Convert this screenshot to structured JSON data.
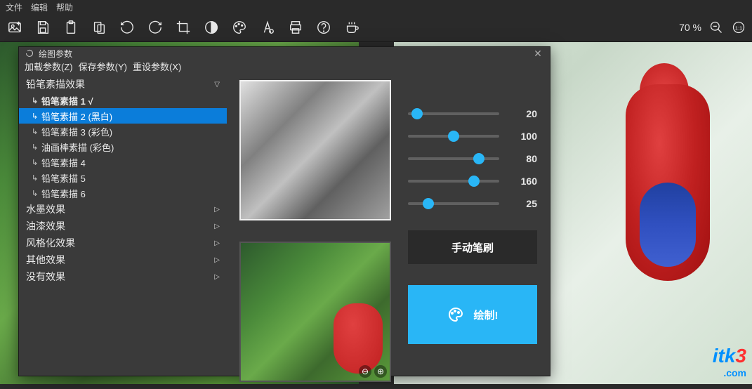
{
  "menubar": {
    "items": [
      "文件",
      "编辑",
      "帮助"
    ]
  },
  "zoom": {
    "level": "70 %"
  },
  "dialog": {
    "title": "绘图参数",
    "menu": {
      "load": "加载参数(Z)",
      "save": "保存参数(Y)",
      "reset": "重设参数(X)"
    },
    "categories": {
      "pencil": {
        "label": "铅笔素描效果",
        "expanded": true
      },
      "ink": {
        "label": "水墨效果"
      },
      "paint": {
        "label": "油漆效果"
      },
      "style": {
        "label": "风格化效果"
      },
      "other": {
        "label": "其他效果"
      },
      "none": {
        "label": "没有效果"
      }
    },
    "presets": [
      {
        "label": "铅笔素描 1 √",
        "checked": true
      },
      {
        "label": "铅笔素描 2 (黑白)",
        "selected": true
      },
      {
        "label": "铅笔素描 3 (彩色)"
      },
      {
        "label": "油画棒素描 (彩色)"
      },
      {
        "label": "铅笔素描 4"
      },
      {
        "label": "铅笔素描 5"
      },
      {
        "label": "铅笔素描 6"
      }
    ],
    "sliders": [
      {
        "value": "20",
        "pos": 10
      },
      {
        "value": "100",
        "pos": 50
      },
      {
        "value": "80",
        "pos": 78
      },
      {
        "value": "160",
        "pos": 72
      },
      {
        "value": "25",
        "pos": 22
      }
    ],
    "buttons": {
      "manual": "手动笔刷",
      "draw": "绘制!"
    }
  },
  "watermark": {
    "itk": "itk",
    "three": "3",
    "com": ".com"
  }
}
